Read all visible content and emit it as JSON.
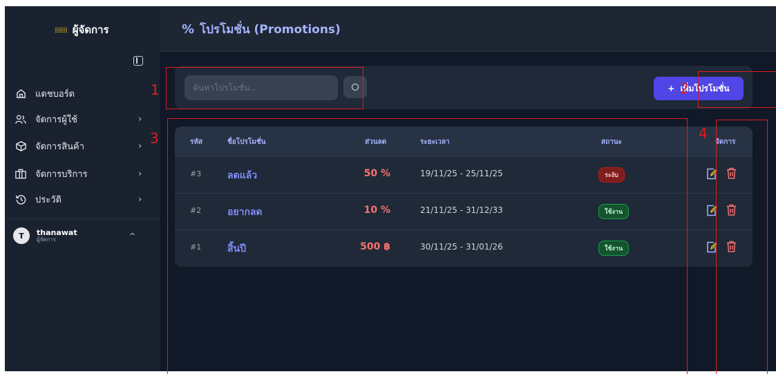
{
  "brand": {
    "title": "ผู้จัดการ",
    "logo_icon": "brand-logo-icon"
  },
  "sidebar": {
    "items": [
      {
        "label": "แดชบอร์ด",
        "icon": "home-icon",
        "has_chevron": false
      },
      {
        "label": "จัดการผู้ใช้",
        "icon": "users-icon",
        "has_chevron": true
      },
      {
        "label": "จัดการสินค้า",
        "icon": "box-icon",
        "has_chevron": true
      },
      {
        "label": "จัดการบริการ",
        "icon": "store-icon",
        "has_chevron": true
      },
      {
        "label": "ประวัติ",
        "icon": "history-icon",
        "has_chevron": true
      }
    ],
    "chevron": "›",
    "user": {
      "initial": "T",
      "name": "thanawat",
      "role": "ผู้จัดการ",
      "chevron": "^"
    }
  },
  "header": {
    "icon_text": "%",
    "title": "โปรโมชั่น (Promotions)"
  },
  "toolbar": {
    "search_placeholder": "ค้นหาโปรโมชั่น...",
    "add_button": {
      "plus": "+",
      "label": "เพิ่มโปรโมชั่น"
    }
  },
  "table": {
    "headers": {
      "id": "รหัส",
      "name": "ชื่อโปรโมชั่น",
      "discount": "ส่วนลด",
      "period": "ระยะเวลา",
      "status": "สถานะ",
      "actions": "จัดการ"
    },
    "rows": [
      {
        "id": "#3",
        "name": "ลดแล้ว",
        "discount": "50 %",
        "period": "19/11/25 - 25/11/25",
        "status": "ระงับ",
        "status_type": "paused"
      },
      {
        "id": "#2",
        "name": "อยากลด",
        "discount": "10 %",
        "period": "21/11/25 - 31/12/33",
        "status": "ใช้งาน",
        "status_type": "active"
      },
      {
        "id": "#1",
        "name": "สิ้นปี",
        "discount": "500 ฿",
        "period": "30/11/25 - 31/01/26",
        "status": "ใช้งาน",
        "status_type": "active"
      }
    ]
  },
  "annotations": {
    "a1": "1",
    "a2": "2",
    "a3": "3",
    "a4": "4"
  },
  "colors": {
    "accent": "#4f46e5",
    "annotation": "#e11d1d",
    "paused": "#7f1d1d",
    "active": "#14532d"
  }
}
